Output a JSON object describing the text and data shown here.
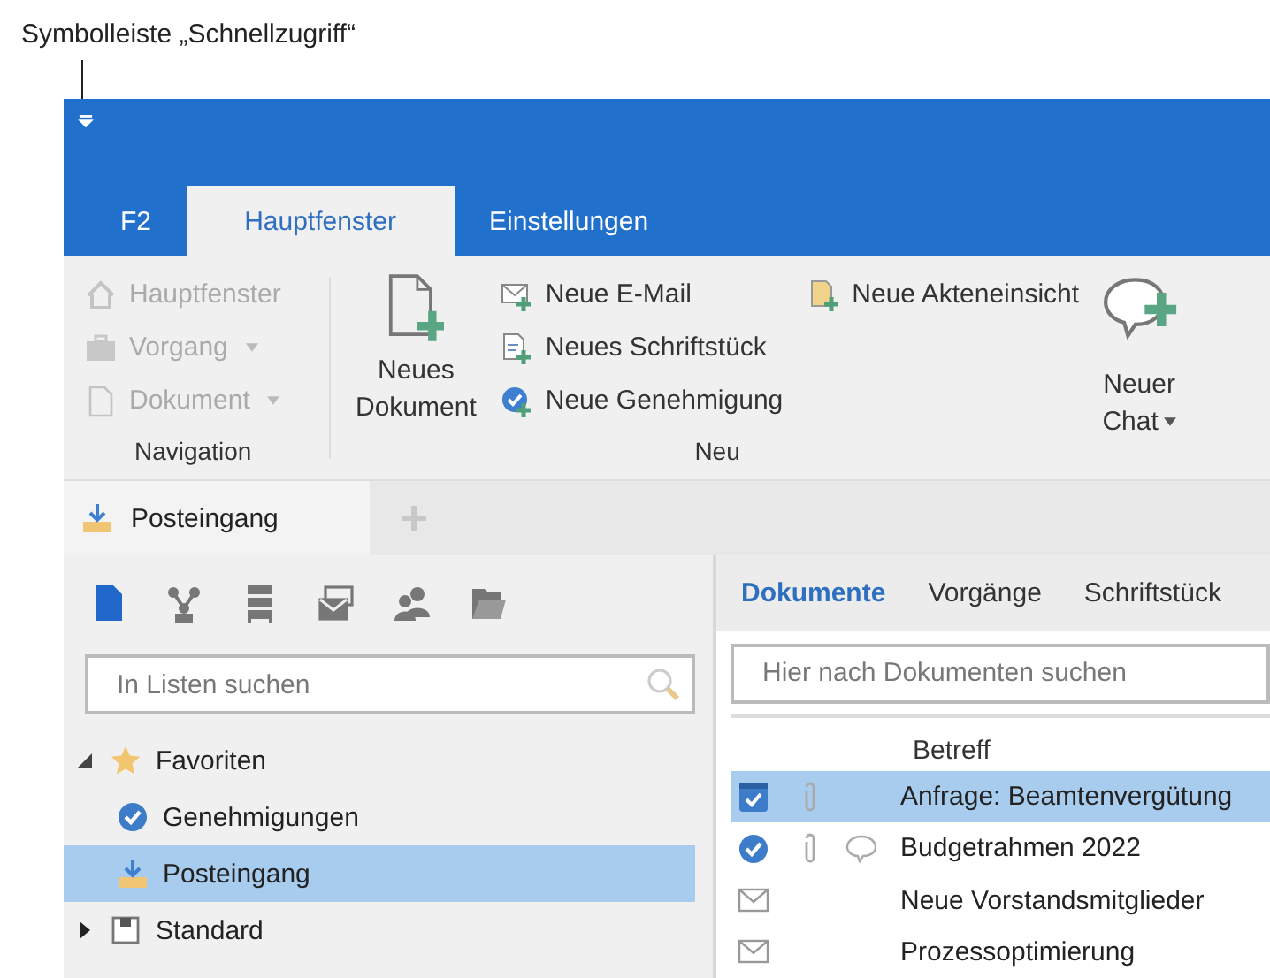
{
  "annotation": {
    "label": "Symbolleiste „Schnellzugriff“"
  },
  "tabs": [
    {
      "label": "F2",
      "selected": false
    },
    {
      "label": "Hauptfenster",
      "selected": true
    },
    {
      "label": "Einstellungen",
      "selected": false
    }
  ],
  "ribbon": {
    "navigation": {
      "label": "Navigation",
      "items": [
        {
          "label": "Hauptfenster",
          "kind": "home",
          "dropdown": false,
          "disabled": true
        },
        {
          "label": "Vorgang",
          "kind": "case",
          "dropdown": true,
          "disabled": true
        },
        {
          "label": "Dokument",
          "kind": "doc",
          "dropdown": true,
          "disabled": true
        }
      ]
    },
    "neu": {
      "label": "Neu",
      "big": {
        "label_lines": [
          "Neues",
          "Dokument"
        ]
      },
      "items": [
        {
          "label": "Neue E-Mail",
          "kind": "mail"
        },
        {
          "label": "Neues Schriftstück",
          "kind": "letter"
        },
        {
          "label": "Neue Genehmigung",
          "kind": "approval"
        }
      ],
      "extra": [
        {
          "label": "Neue Akteneinsicht",
          "kind": "file"
        }
      ]
    },
    "chat": {
      "label_lines": [
        "Neuer",
        "Chat"
      ]
    }
  },
  "doc_tabs": [
    {
      "label": "Posteingang"
    }
  ],
  "left_toolbar": [
    {
      "kind": "doc",
      "selected": true
    },
    {
      "kind": "network",
      "selected": false
    },
    {
      "kind": "cabinet",
      "selected": false
    },
    {
      "kind": "mail",
      "selected": false
    },
    {
      "kind": "people",
      "selected": false
    },
    {
      "kind": "folder",
      "selected": false
    }
  ],
  "list_search": {
    "placeholder": "In Listen suchen"
  },
  "tree": [
    {
      "label": "Favoriten",
      "kind": "star",
      "expanded": true,
      "selected": false,
      "children": [
        {
          "label": "Genehmigungen",
          "kind": "approval",
          "selected": false
        },
        {
          "label": "Posteingang",
          "kind": "inbox",
          "selected": true
        }
      ]
    },
    {
      "label": "Standard",
      "kind": "box",
      "expanded": false,
      "selected": false
    }
  ],
  "right_tabs": [
    {
      "label": "Dokumente",
      "selected": true
    },
    {
      "label": "Vorgänge",
      "selected": false
    },
    {
      "label": "Schriftstück",
      "selected": false
    }
  ],
  "doc_search": {
    "placeholder": "Hier nach Dokumenten suchen"
  },
  "table": {
    "columns": [
      "Betreff"
    ],
    "rows": [
      {
        "kind": "approval-doc",
        "attachment": true,
        "comment": false,
        "selected": true,
        "subject": "Anfrage: Beamtenvergütung"
      },
      {
        "kind": "approval",
        "attachment": true,
        "comment": true,
        "selected": false,
        "subject": "Budgetrahmen 2022"
      },
      {
        "kind": "mail",
        "attachment": false,
        "comment": false,
        "selected": false,
        "subject": "Neue Vorstandsmitglieder"
      },
      {
        "kind": "mail",
        "attachment": false,
        "comment": false,
        "selected": false,
        "subject": "Prozessoptimierung"
      }
    ]
  }
}
